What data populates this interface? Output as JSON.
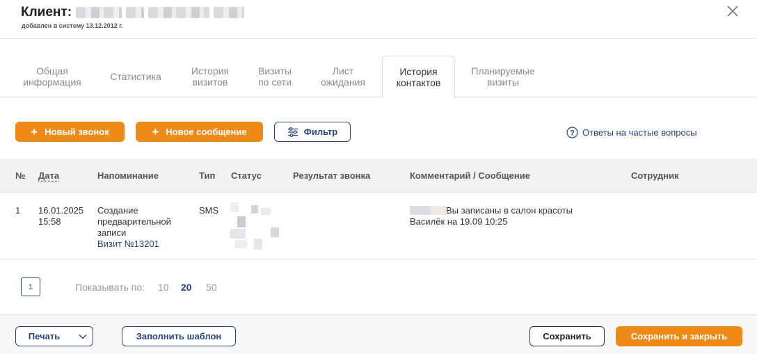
{
  "header": {
    "title_prefix": "Клиент:",
    "subtitle": "добавлен в систему 13.12.2012 г."
  },
  "tabs": [
    {
      "label": "Общая\nинформация",
      "active": false
    },
    {
      "label": "Статистика",
      "active": false
    },
    {
      "label": "История\nвизитов",
      "active": false
    },
    {
      "label": "Визиты\nпо сети",
      "active": false
    },
    {
      "label": "Лист\nожидания",
      "active": false
    },
    {
      "label": "История\nконтактов",
      "active": true
    },
    {
      "label": "Планируемые\nвизиты",
      "active": false
    }
  ],
  "toolbar": {
    "new_call": "Новый звонок",
    "new_message": "Новое сообщение",
    "filter": "Фильтр",
    "faq": "Ответы на частые вопросы"
  },
  "table": {
    "columns": [
      "№",
      "Дата",
      "Напоминание",
      "Тип",
      "Статус",
      "Результат звонка",
      "Комментарий / Сообщение",
      "Сотрудник"
    ],
    "rows": [
      {
        "num": "1",
        "date": "16.01.2025",
        "time": "15:58",
        "reminder": "Создание предварительной записи",
        "visit_link": "Визит №13201",
        "type": "SMS",
        "result": "",
        "comment_line1": "Вы записаны в салон красоты",
        "comment_line2": "Василёк на 19.09 10:25",
        "employee": ""
      }
    ]
  },
  "pagination": {
    "current_page": "1",
    "show_label": "Показывать по:",
    "sizes": [
      "10",
      "20",
      "50"
    ],
    "active_size": "20"
  },
  "footer": {
    "print": "Печать",
    "fill_template": "Заполнить шаблон",
    "save": "Сохранить",
    "save_close": "Сохранить и закрыть"
  },
  "colors": {
    "accent_orange": "#ed8a18",
    "accent_navy": "#25447a"
  }
}
